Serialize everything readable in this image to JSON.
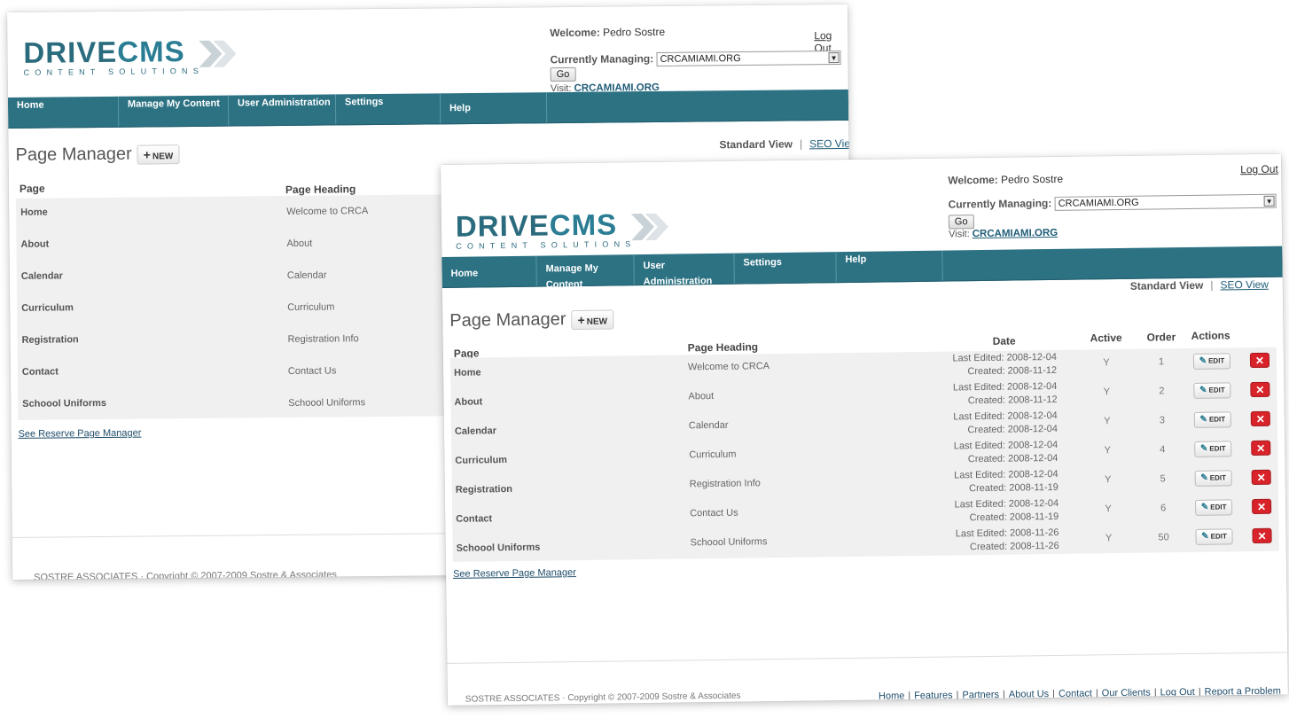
{
  "logo": {
    "main_left": "DRIVE",
    "main_right": "CMS",
    "sub": "CONTENT SOLUTIONS"
  },
  "header": {
    "welcome_label": "Welcome:",
    "welcome_user": "Pedro Sostre",
    "logout": "Log Out",
    "managing_label": "Currently Managing:",
    "managing_value": "CRCAMIAMI.ORG",
    "go": "Go",
    "visit_label": "Visit:",
    "visit_link": "CRCAMIAMI.ORG"
  },
  "nav": [
    "Home",
    "Manage My Content",
    "User Administration",
    "Settings",
    "Help"
  ],
  "views": {
    "standard": "Standard View",
    "separator": "|",
    "seo": "SEO View"
  },
  "page_title": "Page Manager",
  "new_button": "NEW",
  "columns": {
    "page": "Page",
    "heading": "Page Heading",
    "date": "Date",
    "active": "Active",
    "order": "Order",
    "actions": "Actions"
  },
  "edit_label": "EDIT",
  "delete_label": "✕",
  "rows": [
    {
      "page": "Home",
      "heading": "Welcome to CRCA",
      "edited": "Last Edited: 2008-12-04",
      "created": "Created: 2008-11-12",
      "active": "Y",
      "order": "1"
    },
    {
      "page": "About",
      "heading": "About",
      "edited": "Last Edited: 2008-12-04",
      "created": "Created: 2008-11-12",
      "active": "Y",
      "order": "2"
    },
    {
      "page": "Calendar",
      "heading": "Calendar",
      "edited": "Last Edited: 2008-12-04",
      "created": "Created: 2008-12-04",
      "active": "Y",
      "order": "3"
    },
    {
      "page": "Curriculum",
      "heading": "Curriculum",
      "edited": "Last Edited: 2008-12-04",
      "created": "Created: 2008-12-04",
      "active": "Y",
      "order": "4"
    },
    {
      "page": "Registration",
      "heading": "Registration Info",
      "edited": "Last Edited: 2008-12-04",
      "created": "Created: 2008-11-19",
      "active": "Y",
      "order": "5"
    },
    {
      "page": "Contact",
      "heading": "Contact Us",
      "edited": "Last Edited: 2008-12-04",
      "created": "Created: 2008-11-19",
      "active": "Y",
      "order": "6"
    },
    {
      "page": "Schoool Uniforms",
      "heading": "Schoool Uniforms",
      "edited": "Last Edited: 2008-11-26",
      "created": "Created: 2008-11-26",
      "active": "Y",
      "order": "50"
    }
  ],
  "reserve_link": "See Reserve Page Manager",
  "copyright": "SOSTRE ASSOCIATES · Copyright © 2007-2009 Sostre & Associates",
  "footer_links": [
    "Home",
    "Features",
    "Partners",
    "About Us",
    "Contact",
    "Our Clients",
    "Log Out",
    "Report a Problem"
  ],
  "colors": {
    "nav": "#2c7283",
    "brand": "#2b6b7e",
    "delete": "#d8232a"
  }
}
